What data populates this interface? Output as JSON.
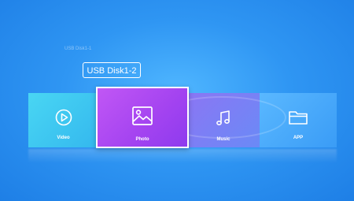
{
  "disk_list": {
    "previous": "USB Disk1-1",
    "selected": "USB Disk1-2"
  },
  "tiles": [
    {
      "label": "Video",
      "icon": "video-play-icon"
    },
    {
      "label": "Photo",
      "icon": "photo-icon"
    },
    {
      "label": "Music",
      "icon": "music-note-icon"
    },
    {
      "label": "APP",
      "icon": "folder-icon"
    }
  ],
  "colors": {
    "background": "#2f96f3",
    "video": "#49d6f3",
    "photo": "#b24ff3",
    "music": "#7b80f5",
    "app": "#4aaefc",
    "focus_border": "#ffffff"
  }
}
